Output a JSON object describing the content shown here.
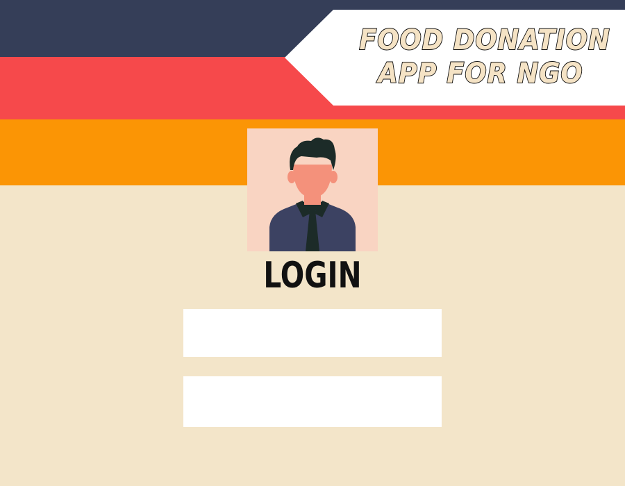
{
  "header": {
    "title_lines": [
      "FOOD DONATION",
      "APP FOR NGO"
    ]
  },
  "avatar": {
    "icon": "user-avatar-icon"
  },
  "login": {
    "heading": "LOGIN",
    "field_1": {
      "value": "",
      "placeholder": ""
    },
    "field_2": {
      "value": "",
      "placeholder": ""
    }
  },
  "colors": {
    "navy_band": "#353e58",
    "red_band": "#f6494b",
    "orange_band": "#fb9505",
    "background": "#f3e5c9",
    "avatar_background": "#f9d4c2",
    "title_fill": "#f5e3c5",
    "title_outline": "#111111"
  }
}
